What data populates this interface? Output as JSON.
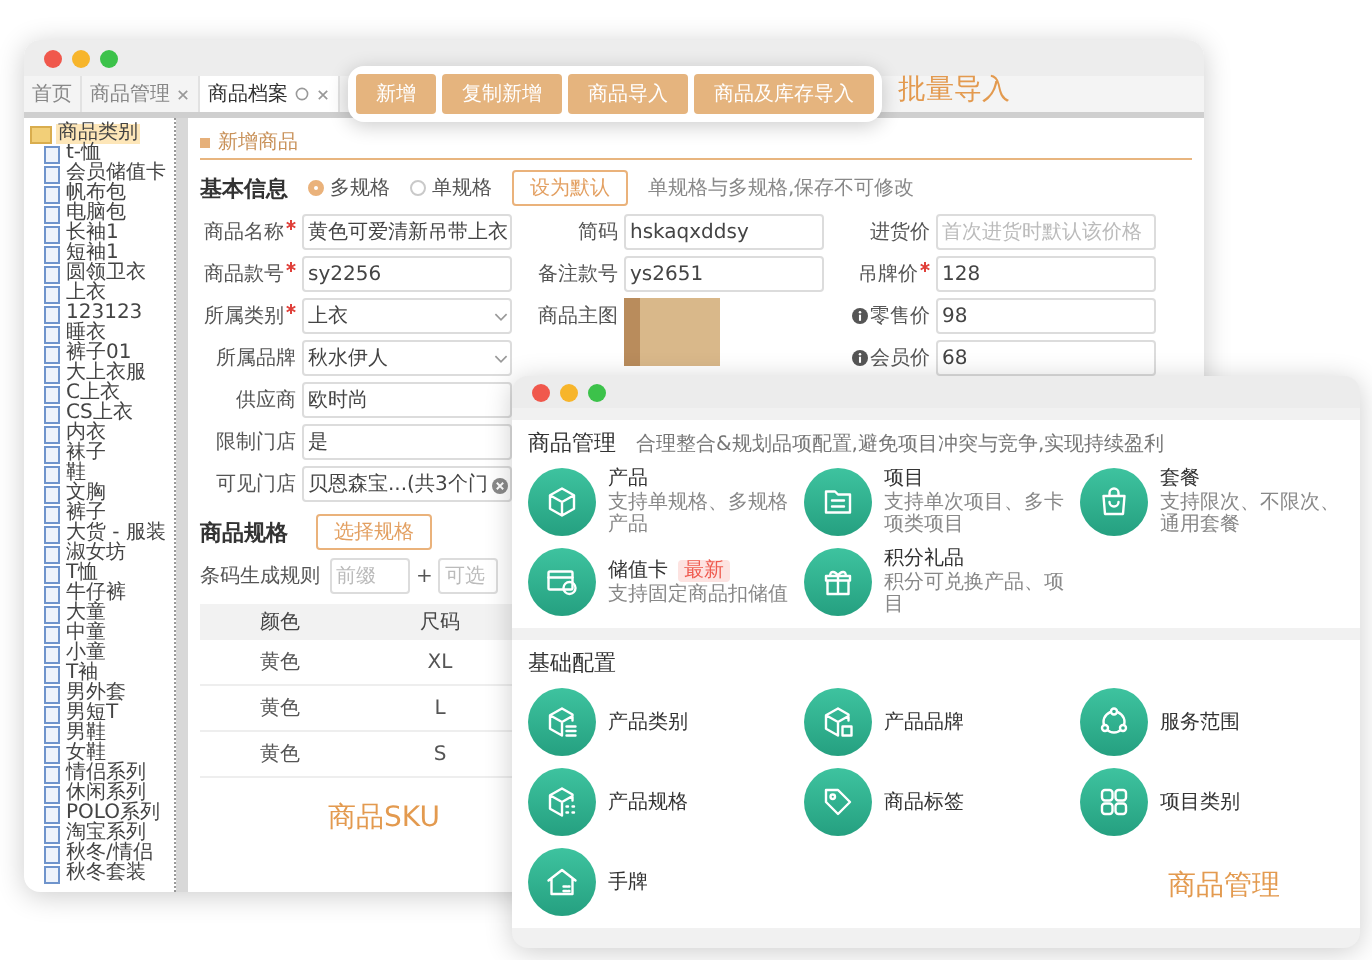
{
  "back_window": {
    "tabs": [
      {
        "label": "首页",
        "closable": false,
        "selected": false
      },
      {
        "label": "商品管理",
        "closable": true,
        "selected": false
      },
      {
        "label": "商品档案",
        "closable": true,
        "selected": true
      }
    ],
    "category_tree": {
      "label": "商品类别",
      "selected": true,
      "children": [
        {
          "label": "t-恤",
          "selected": false
        },
        {
          "label": "会员储值卡",
          "selected": false
        },
        {
          "label": "帆布包",
          "selected": false
        },
        {
          "label": "电脑包",
          "selected": false
        },
        {
          "label": "长袖1",
          "selected": false
        },
        {
          "label": "短袖1",
          "selected": false
        },
        {
          "label": "圆领卫衣",
          "selected": false
        },
        {
          "label": "上衣",
          "selected": false
        },
        {
          "label": "123123",
          "selected": false
        },
        {
          "label": "睡衣",
          "selected": false
        },
        {
          "label": "裤子01",
          "selected": false
        },
        {
          "label": "大上衣服",
          "selected": false
        },
        {
          "label": "C上衣",
          "selected": false
        },
        {
          "label": "CS上衣",
          "selected": false
        },
        {
          "label": "内衣",
          "selected": false
        },
        {
          "label": "袜子",
          "selected": false
        },
        {
          "label": "鞋",
          "selected": false
        },
        {
          "label": "文胸",
          "selected": false
        },
        {
          "label": "裤子",
          "selected": false
        },
        {
          "label": "大货 - 服装",
          "selected": false
        },
        {
          "label": "淑女坊",
          "selected": false
        },
        {
          "label": "T恤",
          "selected": false
        },
        {
          "label": "牛仔裤",
          "selected": false
        },
        {
          "label": "大童",
          "selected": false
        },
        {
          "label": "中童",
          "selected": false
        },
        {
          "label": "小童",
          "selected": false
        },
        {
          "label": "T袖",
          "selected": false
        },
        {
          "label": "男外套",
          "selected": false
        },
        {
          "label": "男短T",
          "selected": false
        },
        {
          "label": "男鞋",
          "selected": false
        },
        {
          "label": "女鞋",
          "selected": false
        },
        {
          "label": "情侣系列",
          "selected": false
        },
        {
          "label": "休闲系列",
          "selected": false
        },
        {
          "label": "POLO系列",
          "selected": false
        },
        {
          "label": "淘宝系列",
          "selected": false
        },
        {
          "label": "秋冬/情侣",
          "selected": false
        },
        {
          "label": "秋冬套装",
          "selected": false
        }
      ]
    },
    "form": {
      "title": "新增商品",
      "heading": "基本信息",
      "modes": [
        {
          "label": "多规格",
          "selected": true
        },
        {
          "label": "单规格",
          "selected": false
        }
      ],
      "default_button": "设为默认",
      "hint": "单规格与多规格,保存不可修改",
      "columns": [
        [
          {
            "label": "商品名称",
            "required": true,
            "kind": "input",
            "value": "黄色可爱清新吊带上衣"
          },
          {
            "label": "商品款号",
            "required": true,
            "kind": "input",
            "value": "sy2256"
          },
          {
            "label": "所属类别",
            "required": true,
            "kind": "select",
            "value": "上衣"
          },
          {
            "label": "所属品牌",
            "required": false,
            "kind": "select",
            "value": "秋水伊人"
          },
          {
            "label": "供应商",
            "required": false,
            "kind": "input",
            "value": "欧时尚"
          },
          {
            "label": "限制门店",
            "required": false,
            "kind": "input",
            "value": "是"
          },
          {
            "label": "可见门店",
            "required": false,
            "kind": "tags",
            "value": "贝恩森宝...(共3个门"
          }
        ],
        [
          {
            "label": "简码",
            "required": false,
            "kind": "input",
            "value": "hskaqxddsy"
          },
          {
            "label": "备注款号",
            "required": false,
            "kind": "input",
            "value": "ys2651"
          },
          {
            "label": "商品主图",
            "required": false,
            "kind": "image"
          }
        ],
        [
          {
            "label": "进货价",
            "required": false,
            "info": false,
            "kind": "input",
            "placeholder": "首次进货时默认该价格"
          },
          {
            "label": "吊牌价",
            "required": true,
            "info": false,
            "kind": "input",
            "value": "128"
          },
          {
            "label": "零售价",
            "required": false,
            "info": true,
            "kind": "input",
            "value": "98"
          },
          {
            "label": "会员价",
            "required": false,
            "info": true,
            "kind": "input",
            "value": "68"
          }
        ]
      ],
      "spec": {
        "heading": "商品规格",
        "select_button": "选择规格",
        "barcode_label": "条码生成规则",
        "prefix_placeholder": "前缀",
        "joiner": "+",
        "optional_placeholder": "可选"
      },
      "sku_table": {
        "columns": [
          "颜色",
          "尺码"
        ],
        "rows": [
          [
            "黄色",
            "XL"
          ],
          [
            "黄色",
            "L"
          ],
          [
            "黄色",
            "S"
          ]
        ]
      }
    },
    "caption": "商品SKU"
  },
  "toolbar": {
    "buttons": [
      "新增",
      "复制新增",
      "商品导入",
      "商品及库存导入"
    ],
    "caption": "批量导入"
  },
  "front_window": {
    "sections": [
      {
        "title": "商品管理",
        "description": "合理整合&规划品项配置,避免项目冲突与竞争,实现持续盈利",
        "items": [
          {
            "kind": "product",
            "title": "产品",
            "description": "支持单规格、多规格产品"
          },
          {
            "kind": "project",
            "title": "项目",
            "description": "支持单次项目、多卡项类项目"
          },
          {
            "kind": "package",
            "title": "套餐",
            "description": "支持限次、不限次、通用套餐"
          },
          {
            "kind": "card",
            "title": "储值卡",
            "badge": "最新",
            "description": "支持固定商品扣储值"
          },
          {
            "kind": "gift",
            "title": "积分礼品",
            "description": "积分可兑换产品、项目"
          }
        ]
      },
      {
        "title": "基础配置",
        "items": [
          {
            "kind": "category",
            "title": "产品类别"
          },
          {
            "kind": "brand",
            "title": "产品品牌"
          },
          {
            "kind": "service",
            "title": "服务范围"
          },
          {
            "kind": "spec",
            "title": "产品规格"
          },
          {
            "kind": "tag",
            "title": "商品标签"
          },
          {
            "kind": "grid",
            "title": "项目类别"
          },
          {
            "kind": "house",
            "title": "手牌"
          }
        ]
      }
    ],
    "caption": "商品管理"
  }
}
